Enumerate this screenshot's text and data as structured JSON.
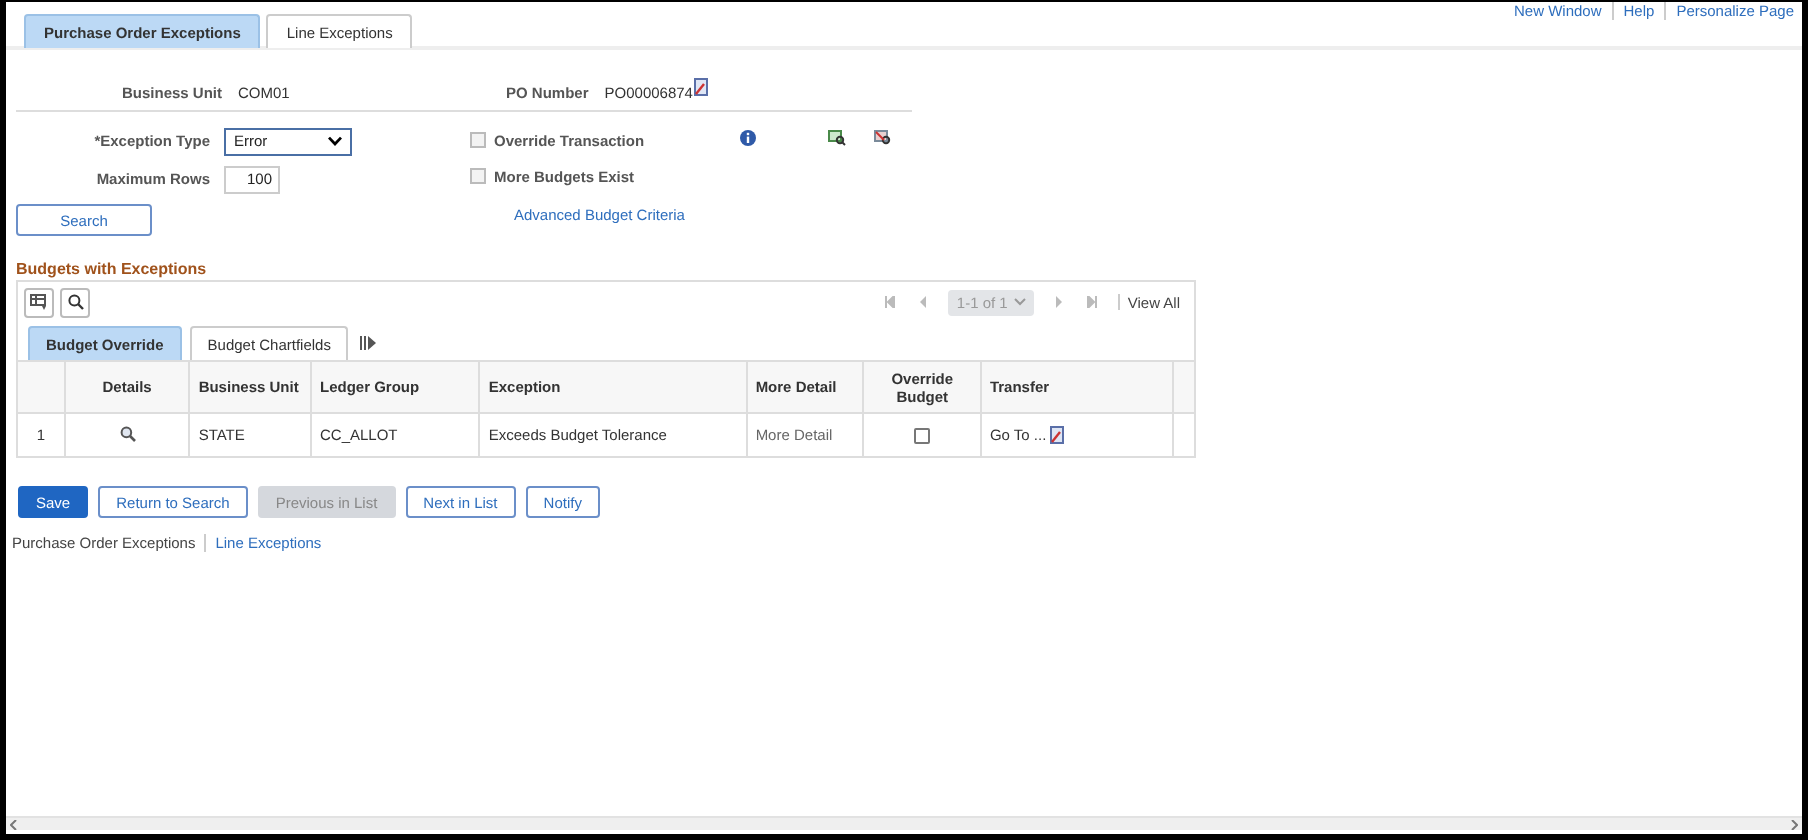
{
  "header_links": [
    "New Window",
    "Help",
    "Personalize Page"
  ],
  "tabs": [
    {
      "label": "Purchase Order Exceptions",
      "selected": true
    },
    {
      "label": "Line Exceptions",
      "selected": false
    }
  ],
  "header_fields": [
    {
      "label": "Business Unit",
      "value": "COM01",
      "link_icon": false
    },
    {
      "label": "PO Number",
      "value": "PO00006874",
      "link_icon": true
    }
  ],
  "exception_type": {
    "label": "*Exception Type",
    "value": "Error"
  },
  "maximum_rows": {
    "label": "Maximum Rows",
    "value": "100"
  },
  "options": [
    {
      "label": "Override Transaction",
      "checked": false,
      "disabled": true
    },
    {
      "label": "More Budgets Exist",
      "checked": false,
      "disabled": true
    }
  ],
  "search_button": "Search",
  "advanced_link": "Advanced Budget Criteria",
  "grid": {
    "title": "Budgets with Exceptions",
    "pager": {
      "range": "1-1 of 1",
      "view_all": "View All"
    },
    "tabs": [
      {
        "label": "Budget Override",
        "selected": true
      },
      {
        "label": "Budget Chartfields",
        "selected": false
      }
    ],
    "columns": [
      "Details",
      "Business Unit",
      "Ledger Group",
      "Exception",
      "More Detail",
      "Override Budget",
      "Transfer"
    ],
    "rows": [
      {
        "number": "1",
        "business_unit": "STATE",
        "ledger_group": "CC_ALLOT",
        "exception": "Exceeds Budget Tolerance",
        "more_detail": "More Detail",
        "override_budget": false,
        "transfer": "Go To ..."
      }
    ]
  },
  "buttons": [
    {
      "label": "Save",
      "kind": "primary",
      "disabled": false
    },
    {
      "label": "Return to Search",
      "kind": "secondary",
      "disabled": false
    },
    {
      "label": "Previous in List",
      "kind": "secondary",
      "disabled": true
    },
    {
      "label": "Next in List",
      "kind": "secondary",
      "disabled": false
    },
    {
      "label": "Notify",
      "kind": "secondary",
      "disabled": false
    }
  ],
  "footer_links": [
    {
      "label": "Purchase Order Exceptions",
      "selected": true
    },
    {
      "label": "Line Exceptions",
      "selected": false
    }
  ]
}
